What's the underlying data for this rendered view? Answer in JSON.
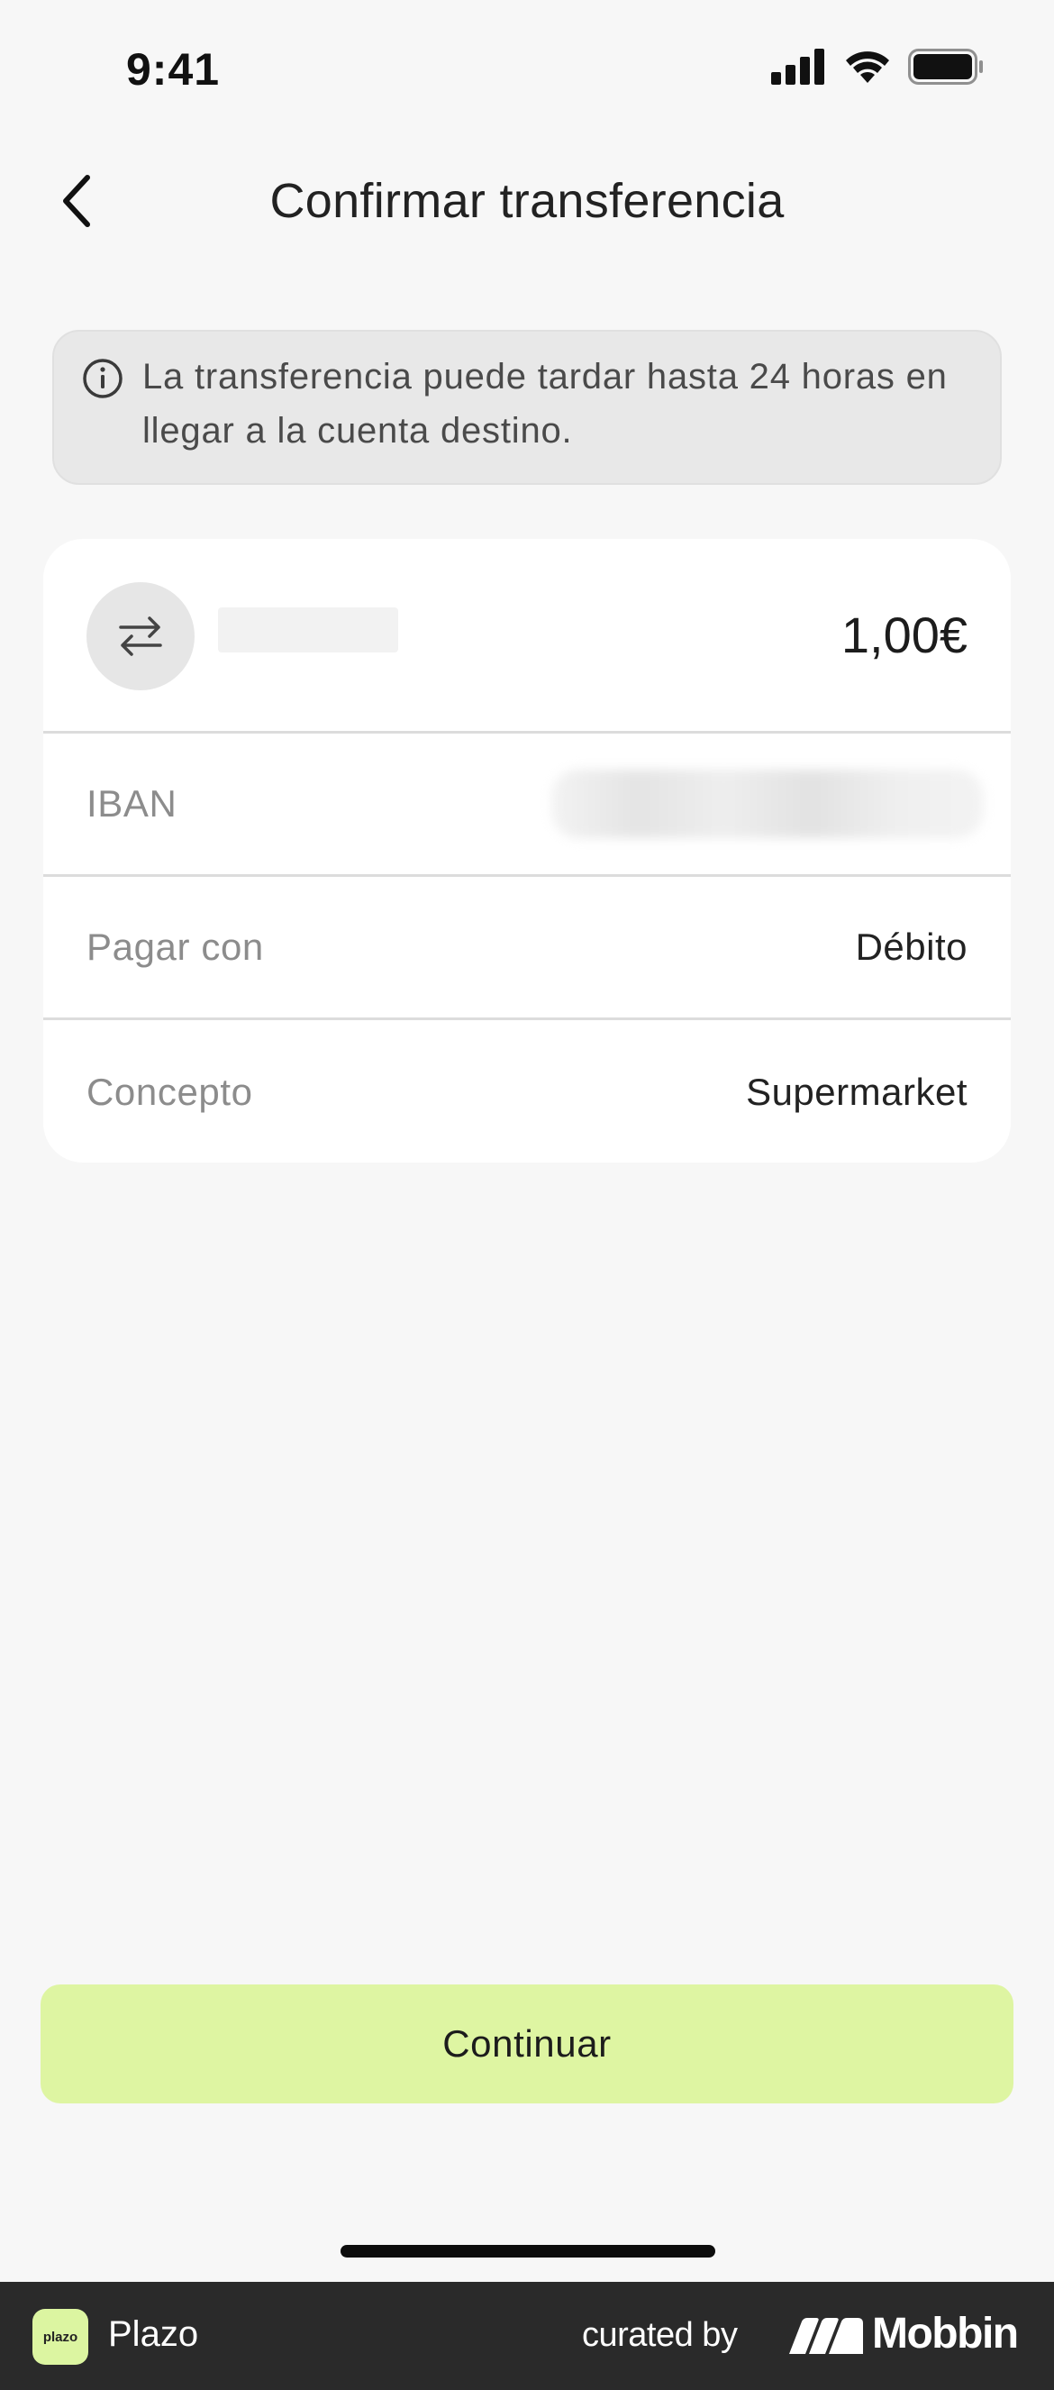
{
  "status_bar": {
    "time": "9:41",
    "icons": [
      "cellular-signal-icon",
      "wifi-icon",
      "battery-icon"
    ]
  },
  "header": {
    "title": "Confirmar transferencia",
    "back_icon": "chevron-left-icon"
  },
  "info_banner": {
    "icon": "info-icon",
    "text": "La transferencia puede tardar hasta 24 horas en llegar a la cuenta destino."
  },
  "transfer": {
    "icon": "transfer-arrows-icon",
    "amount": "1,00€",
    "rows": [
      {
        "label": "IBAN",
        "value": ""
      },
      {
        "label": "Pagar con",
        "value": "Débito"
      },
      {
        "label": "Concepto",
        "value": "Supermarket"
      }
    ]
  },
  "actions": {
    "continue_label": "Continuar"
  },
  "footer": {
    "app_logo_text": "plazo",
    "app_name": "Plazo",
    "curated_by": "curated by",
    "brand": "Mobbin"
  },
  "colors": {
    "background": "#f7f7f7",
    "card": "#ffffff",
    "banner": "#e8e8e8",
    "accent_button": "#def5a2",
    "footer": "#2a2a2a"
  }
}
